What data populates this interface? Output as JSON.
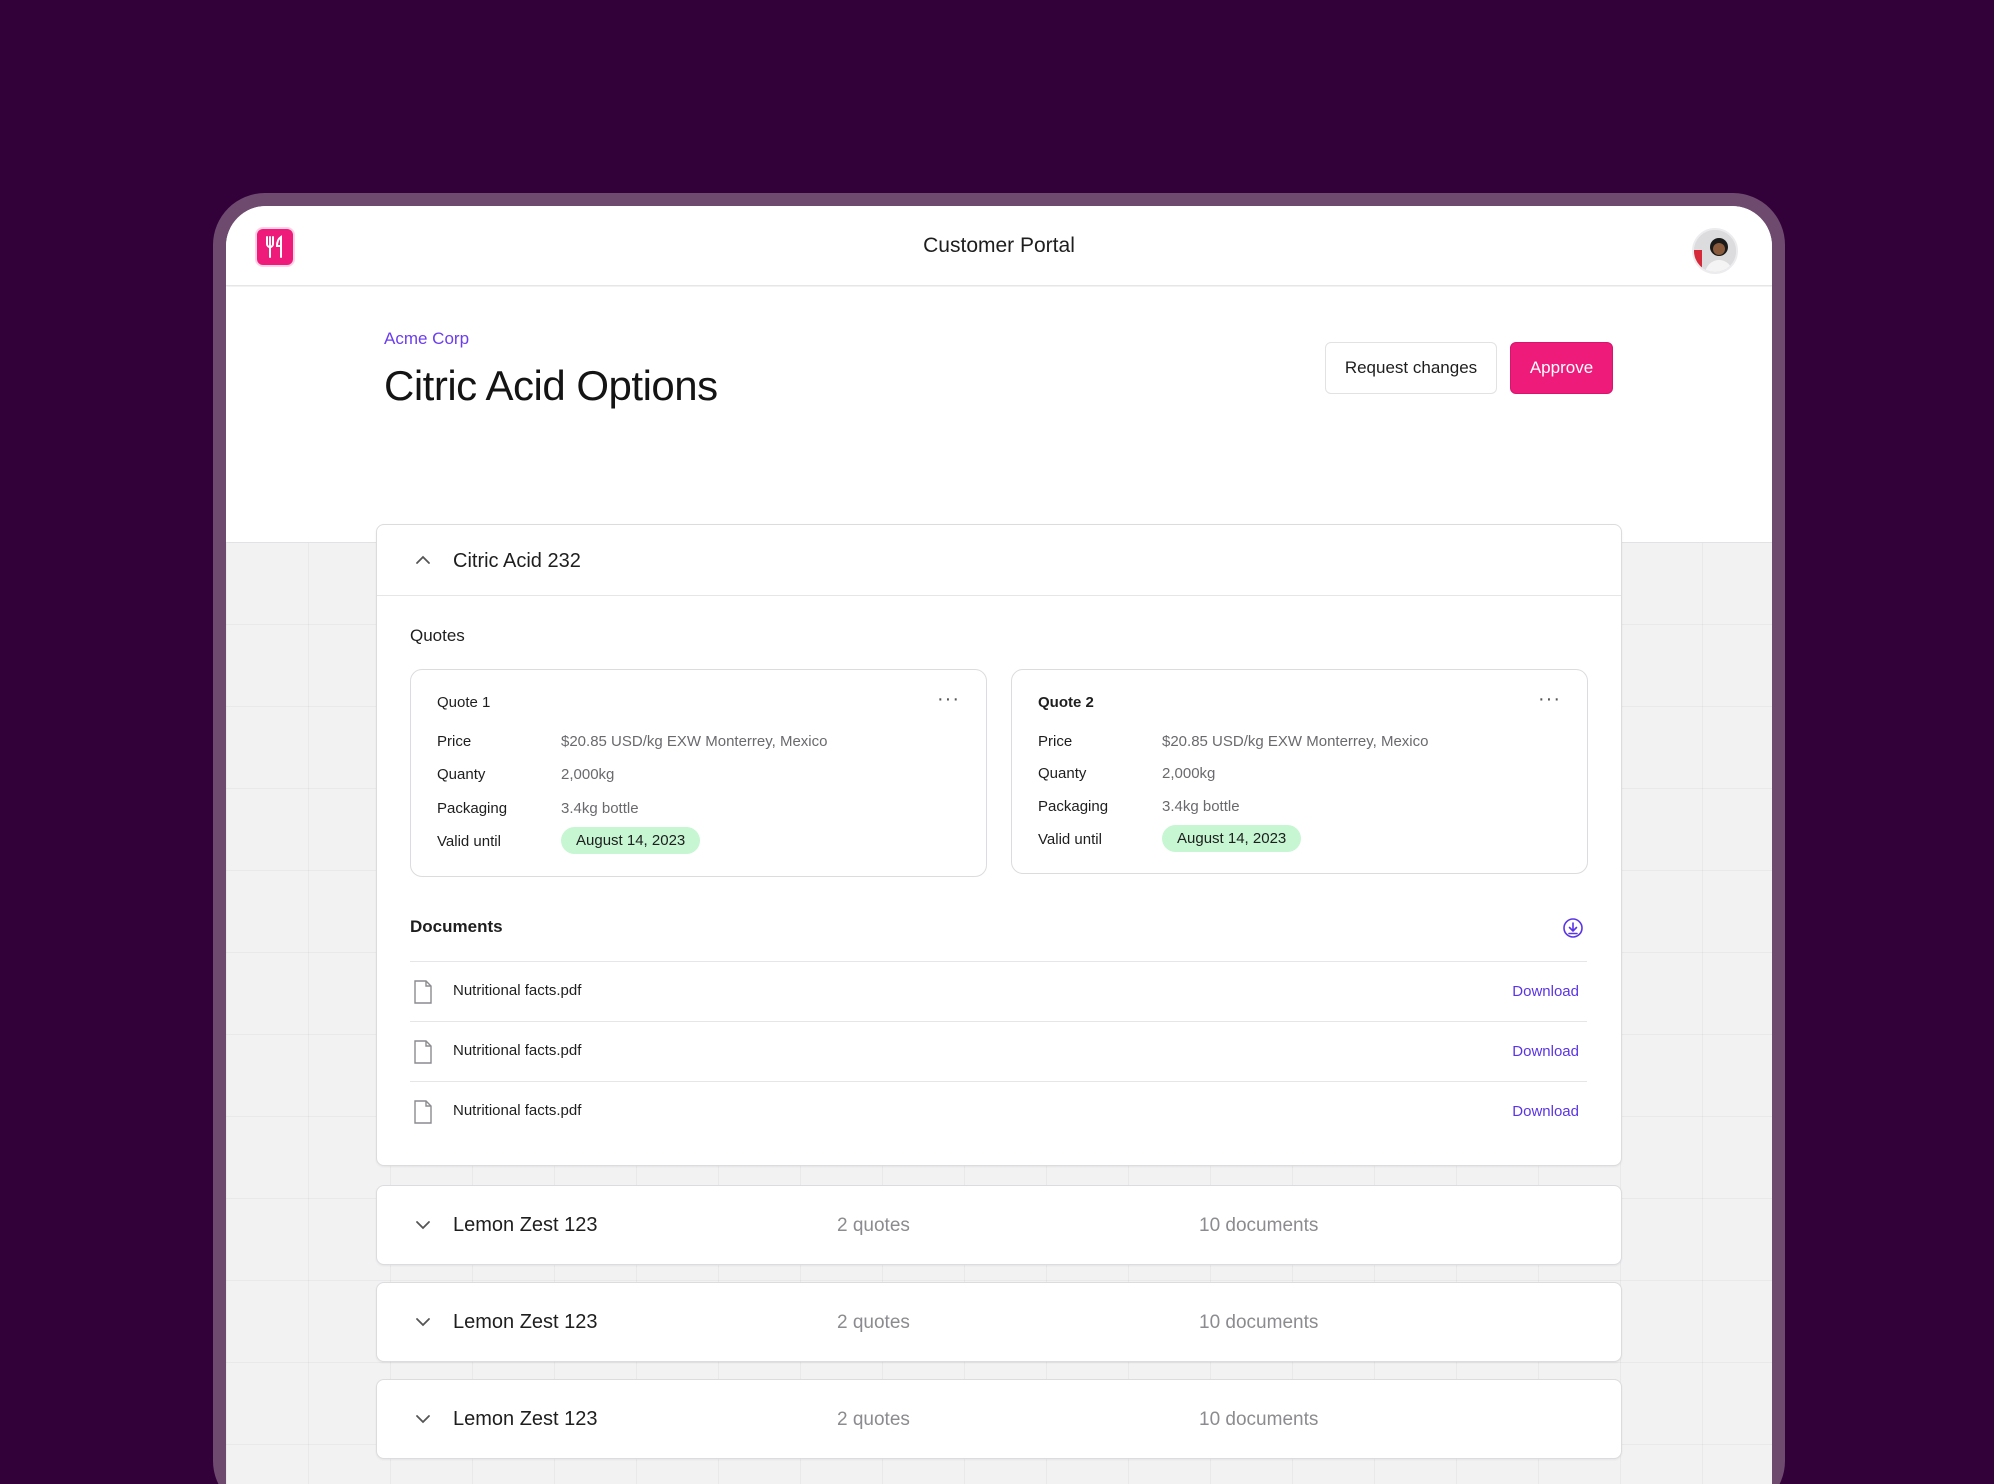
{
  "topbar": {
    "title": "Customer Portal",
    "logo_icon": "utensils-icon"
  },
  "header": {
    "company": "Acme Corp",
    "title": "Citric Acid Options",
    "request_changes_label": "Request changes",
    "approve_label": "Approve"
  },
  "colors": {
    "brand_pink": "#ee1b7a",
    "accent_purple": "#6b3df0",
    "badge_green": "#c6f6d2",
    "background": "#33013a"
  },
  "products": [
    {
      "name": "Citric Acid 232",
      "expanded": true,
      "quotes_label": "Quotes",
      "quotes": [
        {
          "title": "Quote 1",
          "rows": [
            {
              "label": "Price",
              "value": "$20.85 USD/kg EXW Monterrey, Mexico"
            },
            {
              "label": "Quanty",
              "value": "2,000kg"
            },
            {
              "label": "Packaging",
              "value": "3.4kg bottle"
            },
            {
              "label": "Valid until",
              "value": "August 14, 2023"
            }
          ]
        },
        {
          "title": "Quote 2",
          "rows": [
            {
              "label": "Price",
              "value": "$20.85 USD/kg EXW Monterrey, Mexico"
            },
            {
              "label": "Quanty",
              "value": "2,000kg"
            },
            {
              "label": "Packaging",
              "value": "3.4kg bottle"
            },
            {
              "label": "Valid until",
              "value": "August 14, 2023"
            }
          ]
        }
      ],
      "documents_label": "Documents",
      "documents": [
        {
          "name": "Nutritional facts.pdf",
          "action": "Download"
        },
        {
          "name": "Nutritional facts.pdf",
          "action": "Download"
        },
        {
          "name": "Nutritional facts.pdf",
          "action": "Download"
        }
      ]
    },
    {
      "name": "Lemon Zest 123",
      "expanded": false,
      "quotes_count": "2 quotes",
      "documents_count": "10 documents"
    },
    {
      "name": "Lemon Zest 123",
      "expanded": false,
      "quotes_count": "2 quotes",
      "documents_count": "10 documents"
    },
    {
      "name": "Lemon Zest 123",
      "expanded": false,
      "quotes_count": "2 quotes",
      "documents_count": "10 documents"
    }
  ]
}
